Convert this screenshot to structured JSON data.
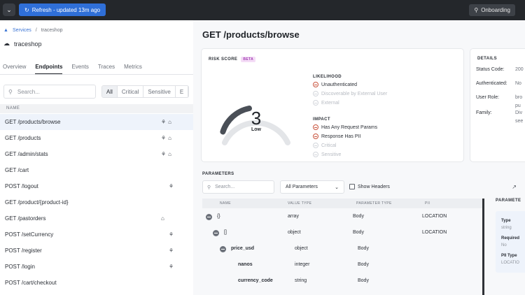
{
  "topbar": {
    "refresh_label": "Refresh - updated 13m ago",
    "onboarding_label": "Onboarding"
  },
  "left": {
    "breadcrumb": {
      "root": "Services",
      "current": "traceshop"
    },
    "service_title": "traceshop",
    "tabs": [
      "Overview",
      "Endpoints",
      "Events",
      "Traces",
      "Metrics"
    ],
    "active_tab": "Endpoints",
    "search_placeholder": "Search...",
    "filters": [
      "All",
      "Critical",
      "Sensitive",
      "E"
    ],
    "list_header": "NAME",
    "endpoints": [
      {
        "name": "GET /products/browse",
        "fp": true,
        "lock": true,
        "selected": true
      },
      {
        "name": "GET /products",
        "fp": true,
        "lock": true
      },
      {
        "name": "GET /admin/stats",
        "fp": true,
        "lock": true
      },
      {
        "name": "GET /cart",
        "fp": false,
        "lock": false
      },
      {
        "name": "POST /logout",
        "fp": true,
        "lock": false
      },
      {
        "name": "GET /product/{product-id}",
        "fp": false,
        "lock": false
      },
      {
        "name": "GET /pastorders",
        "fp": false,
        "lock": true
      },
      {
        "name": "POST /setCurrency",
        "fp": true,
        "lock": false
      },
      {
        "name": "POST /register",
        "fp": true,
        "lock": false
      },
      {
        "name": "POST /login",
        "fp": true,
        "lock": false
      },
      {
        "name": "POST /cart/checkout",
        "fp": false,
        "lock": false
      }
    ]
  },
  "drawer": {
    "title": "GET /products/browse",
    "risk": {
      "label": "RISK SCORE",
      "badge": "BETA",
      "score": "3",
      "score_fraction": 0.42,
      "level": "Low",
      "likelihood_label": "LIKELIHOOD",
      "likelihood": [
        {
          "text": "Unauthenticated",
          "active": true
        },
        {
          "text": "Discoverable by External User",
          "active": false
        },
        {
          "text": "External",
          "active": false
        }
      ],
      "impact_label": "IMPACT",
      "impact": [
        {
          "text": "Has Any Request Params",
          "active": true
        },
        {
          "text": "Response Has PII",
          "active": true
        },
        {
          "text": "Critical",
          "active": false
        },
        {
          "text": "Sensitive",
          "active": false
        }
      ]
    },
    "details": {
      "label": "DETAILS",
      "rows": [
        {
          "key": "Status Code:",
          "value": "200"
        },
        {
          "key": "Authenticated:",
          "value": "No"
        },
        {
          "key": "User Role:",
          "value": "bro"
        },
        {
          "key": "",
          "value": "pu"
        },
        {
          "key": "Family:",
          "value": "Div"
        },
        {
          "key": "",
          "value": "see"
        }
      ]
    },
    "parameters": {
      "label": "PARAMETERS",
      "search_placeholder": "Search...",
      "select_value": "All Parameters",
      "checkbox_label": "Show Headers",
      "columns": [
        "NAME",
        "VALUE TYPE",
        "PARAMETER TYPE",
        "PII"
      ],
      "rows": [
        {
          "name": "{}",
          "value_type": "array",
          "param_type": "Body",
          "pii": "LOCATION",
          "level": 0,
          "toggle": true
        },
        {
          "name": "[]",
          "value_type": "object",
          "param_type": "Body",
          "pii": "LOCATION",
          "level": 1,
          "toggle": true
        },
        {
          "name": "price_usd",
          "value_type": "object",
          "param_type": "Body",
          "pii": "",
          "level": 2,
          "toggle": true
        },
        {
          "name": "nanos",
          "value_type": "integer",
          "param_type": "Body",
          "pii": "",
          "level": 3,
          "toggle": false
        },
        {
          "name": "currency_code",
          "value_type": "string",
          "param_type": "Body",
          "pii": "",
          "level": 3,
          "toggle": false
        }
      ]
    },
    "side": {
      "title": "PARAMETE",
      "items": [
        {
          "label": "Type",
          "value": "string"
        },
        {
          "label": "Required",
          "value": "No"
        },
        {
          "label": "PII Type",
          "value": "LOCATIO"
        }
      ]
    }
  }
}
